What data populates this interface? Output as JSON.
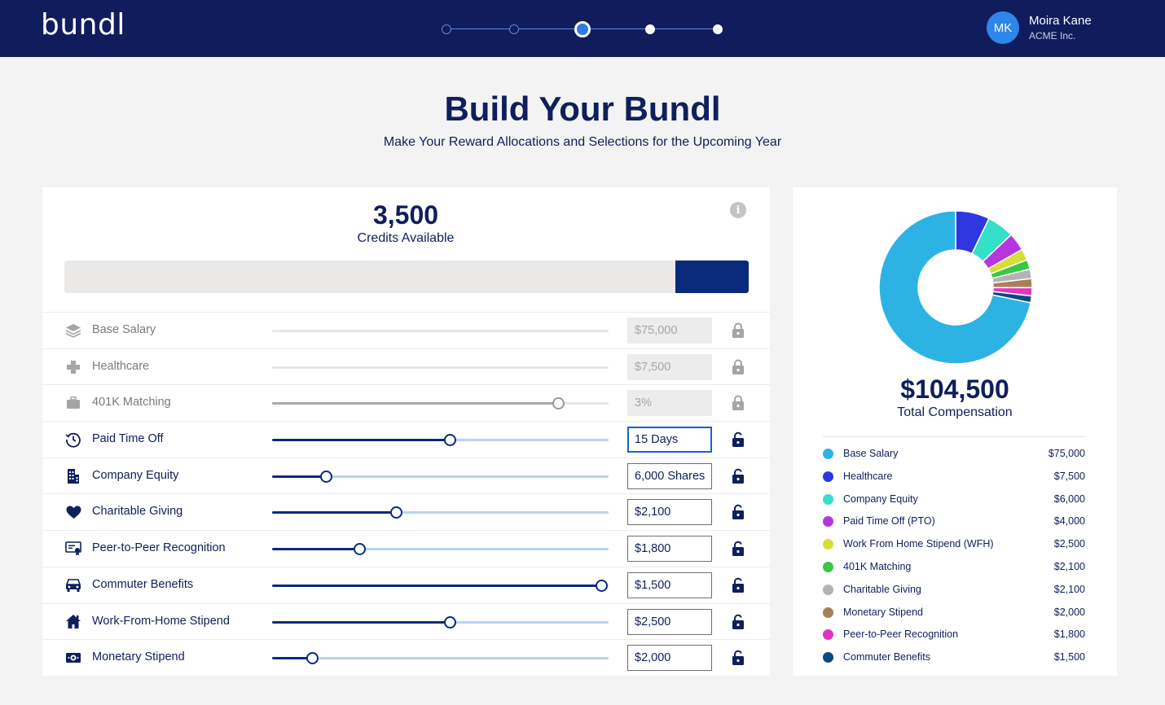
{
  "header": {
    "logo": "bundl",
    "steps": [
      {
        "state": "done"
      },
      {
        "state": "done"
      },
      {
        "state": "current"
      },
      {
        "state": "upcoming"
      },
      {
        "state": "upcoming"
      }
    ],
    "user": {
      "initials": "MK",
      "name": "Moira Kane",
      "org": "ACME Inc."
    }
  },
  "page": {
    "title": "Build Your Bundl",
    "subtitle": "Make Your Reward Allocations and Selections for the Upcoming Year"
  },
  "credits": {
    "value": "3,500",
    "label": "Credits Available",
    "remaining_fraction": 0.107
  },
  "allocations": [
    {
      "label": "Base Salary",
      "icon": "layers-icon",
      "value": "$75,000",
      "locked": true,
      "slider": null
    },
    {
      "label": "Healthcare",
      "icon": "medical-cross-icon",
      "value": "$7,500",
      "locked": true,
      "slider": null
    },
    {
      "label": "401K Matching",
      "icon": "briefcase-icon",
      "value": "3%",
      "locked": true,
      "slider": 0.85
    },
    {
      "label": "Paid Time Off",
      "icon": "clock-history-icon",
      "value": "15 Days",
      "locked": false,
      "slider": 0.53,
      "focused": true
    },
    {
      "label": "Company Equity",
      "icon": "building-icon",
      "value": "6,000 Shares",
      "locked": false,
      "slider": 0.16
    },
    {
      "label": "Charitable Giving",
      "icon": "heart-icon",
      "value": "$2,100",
      "locked": false,
      "slider": 0.37
    },
    {
      "label": "Peer-to-Peer Recognition",
      "icon": "certificate-icon",
      "value": "$1,800",
      "locked": false,
      "slider": 0.26
    },
    {
      "label": "Commuter Benefits",
      "icon": "car-icon",
      "value": "$1,500",
      "locked": false,
      "slider": 0.98
    },
    {
      "label": "Work-From-Home Stipend",
      "icon": "home-icon",
      "value": "$2,500",
      "locked": false,
      "slider": 0.53
    },
    {
      "label": "Monetary Stipend",
      "icon": "cash-icon",
      "value": "$2,000",
      "locked": false,
      "slider": 0.12
    }
  ],
  "summary": {
    "total_value": "$104,500",
    "total_label": "Total Compensation"
  },
  "chart_data": {
    "type": "pie",
    "donut": true,
    "categories": [
      "Base Salary",
      "Healthcare",
      "Company Equity",
      "Paid Time Off (PTO)",
      "Work From Home Stipend (WFH)",
      "401K Matching",
      "Charitable Giving",
      "Monetary Stipend",
      "Peer-to-Peer Recognition",
      "Commuter Benefits"
    ],
    "values": [
      75000,
      7500,
      6000,
      4000,
      2500,
      2100,
      2100,
      2000,
      1800,
      1500
    ],
    "amount_labels": [
      "$75,000",
      "$7,500",
      "$6,000",
      "$4,000",
      "$2,500",
      "$2,100",
      "$2,100",
      "$2,000",
      "$1,800",
      "$1,500"
    ],
    "colors": [
      "#2db3e3",
      "#2f37e0",
      "#35e0c8",
      "#b735e0",
      "#d4e035",
      "#38c844",
      "#b3b3b3",
      "#a88058",
      "#e035c2",
      "#0a4a7c"
    ],
    "legend": "below"
  }
}
